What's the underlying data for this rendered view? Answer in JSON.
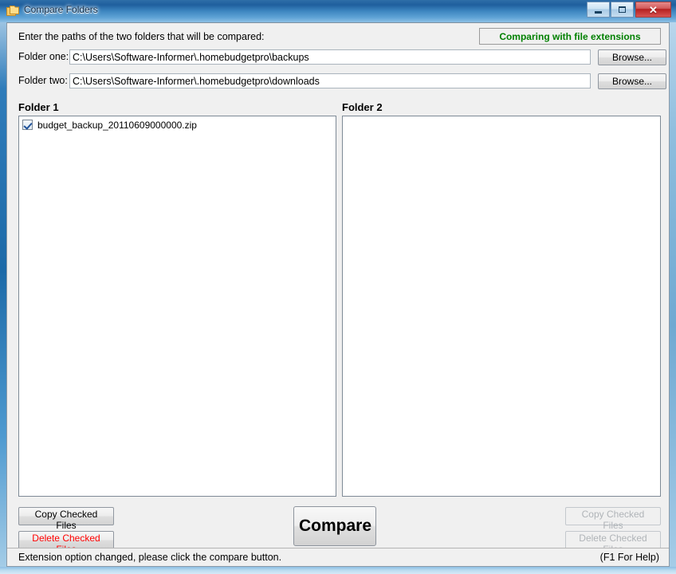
{
  "window": {
    "title": "Compare Folders",
    "icon": "folder-icon",
    "controls": {
      "minimize": "minimize-icon",
      "maximize": "maximize-icon",
      "close_label": "✕"
    }
  },
  "header": {
    "instruction": "Enter the paths of the two folders that will be compared:",
    "extension_status": "Comparing with file extensions",
    "extension_status_color": "#008000"
  },
  "paths": {
    "folder_one": {
      "label": "Folder one:",
      "value": "C:\\Users\\Software-Informer\\.homebudgetpro\\backups",
      "placeholder": "",
      "browse_label": "Browse..."
    },
    "folder_two": {
      "label": "Folder two:",
      "value": "C:\\Users\\Software-Informer\\.homebudgetpro\\downloads",
      "placeholder": "",
      "browse_label": "Browse..."
    }
  },
  "panels": {
    "left": {
      "title": "Folder 1",
      "items": [
        {
          "name": "budget_backup_20110609000000.zip",
          "checked": true
        }
      ],
      "copy_label": "Copy Checked Files",
      "delete_label": "Delete Checked Files",
      "buttons_enabled": true
    },
    "right": {
      "title": "Folder 2",
      "items": [],
      "copy_label": "Copy Checked Files",
      "delete_label": "Delete Checked Files",
      "buttons_enabled": false
    }
  },
  "compare": {
    "label": "Compare"
  },
  "statusbar": {
    "message": "Extension option changed, please click the compare button.",
    "help_hint": "(F1 For Help)"
  }
}
